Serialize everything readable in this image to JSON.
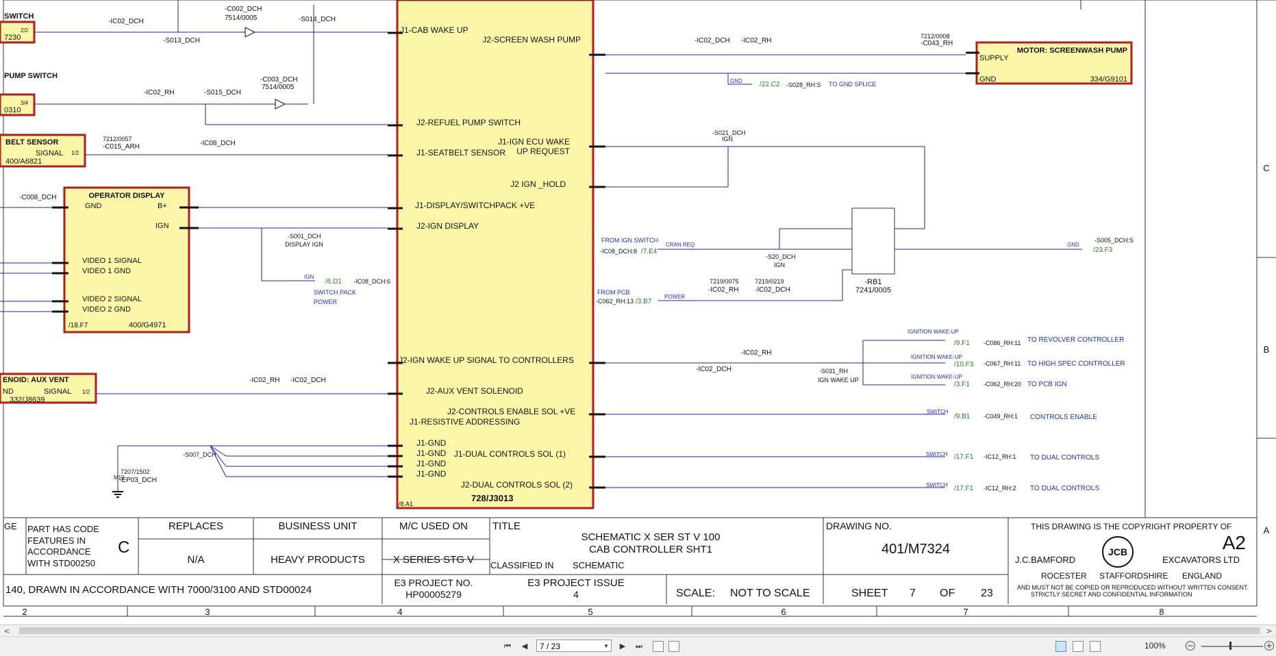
{
  "colors": {
    "wire": "#1c1ccc",
    "box_fill": "#fbf6a8",
    "box_border": "#b21e1e",
    "text": "#111111",
    "link_green": "#1e8a1e",
    "blue_text": "#1a2fcc"
  },
  "connector": {
    "lines": [
      "J1-CAB WAKE UP",
      "J2-SCREEN WASH PUMP",
      "J2-REFUEL PUMP SWITCH",
      "J1-SEATBELT SENSOR",
      "J1-IGN ECU WAKE",
      "UP REQUEST",
      "J2 IGN _HOLD",
      "J1-DISPLAY/SWITCHPACK +VE",
      "J2-IGN DISPLAY",
      "J2-IGN WAKE UP SIGNAL TO CONTROLLERS",
      "J2-AUX VENT SOLENOID",
      "J2-CONTROLS ENABLE SOL +VE",
      "J1-RESISTIVE ADDRESSING",
      "J1-GND",
      "J1-GND",
      "J1-GND",
      "J1-GND",
      "J1-DUAL CONTROLS SOL (1)",
      "J2-DUAL CONTROLS SOL (2)"
    ],
    "part": "728/J3013",
    "ref": "/8.A1"
  },
  "components": {
    "switch": {
      "title": "SWITCH",
      "code": "7230",
      "pin": "2/2"
    },
    "pump_switch": {
      "title": "PUMP SWITCH",
      "code": "0310",
      "pin": "3/4"
    },
    "belt_sensor": {
      "title": "BELT SENSOR",
      "signal": "SIGNAL",
      "pin": "1/2",
      "code": "400/A6821"
    },
    "operator_display": {
      "title": "OPERATOR DISPLAY",
      "gnd": "GND",
      "bplus": "B+",
      "ign": "IGN",
      "v1s": "VIDEO 1 SIGNAL",
      "v1g": "VIDEO 1 GND",
      "v2s": "VIDEO 2 SIGNAL",
      "v2g": "VIDEO 2 GND",
      "ref": "/18.F7",
      "code": "400/G4971"
    },
    "aux_vent": {
      "title": "ENOID: AUX VENT",
      "nd": "ND",
      "signal": "SIGNAL",
      "pin": "1/2",
      "code": "332/J8639"
    },
    "motor": {
      "title": "MOTOR: SCREENWASH PUMP",
      "supply": "SUPPLY",
      "gnd": "GND",
      "code": "334/G9101"
    },
    "relay": {
      "name": "-RB1",
      "code": "7241/0005"
    }
  },
  "wire_labels": [
    "-IC02_DCH",
    "-C002_DCH",
    "7514/0005",
    "-S014_DCH",
    "-S013_DCH",
    "-IC02_RH",
    "-S015_DCH",
    "-C003_DCH",
    "7514/0005",
    "7212/0057",
    "-C015_ARH",
    "-IC08_DCH",
    "-C008_DCH",
    "-S001_DCH",
    "DISPLAY IGN",
    "IGN",
    "/6.D1",
    "-IC08_DCH:6",
    "SWITCH PACK",
    "POWER",
    "-IC02_RH",
    "-IC02_DCH",
    "-S007_DCH",
    "7207/1502",
    "-EP03_DCH",
    "M10",
    "-IC02_DCH",
    "-IC02_RH",
    "7212/0008",
    "-C043_RH",
    "GND",
    "/22.C2",
    "-S028_RH:S",
    "TO GND SPLICE",
    "-S021_DCH",
    "IGN",
    "FROM IGN SWITCH",
    "-IC08_DCH:8",
    "/7.E4",
    "CRAN REQ",
    "-S20_DCH",
    "IGN",
    "GND",
    "-S005_DCH:S",
    "/23.F3",
    "FROM PCB",
    "-C062_RH:13",
    "/3.B7",
    "POWER",
    "7219/0075",
    "-IC02_RH",
    "7219/0219",
    "-IC02_DCH",
    "-IC02_DCH",
    "-IC02_RH",
    "-S031_RH",
    "IGN WAKE UP",
    "IGNITION WAKE-UP",
    "/9.F1",
    "-C086_RH:11",
    "TO REVOLVER CONTROLLER",
    "IGNITION WAKE-UP",
    "/10.F3",
    "-C067_RH:11",
    "TO HIGH SPEC CONTROLLER",
    "IGNITION WAKE-UP",
    "/3.F1",
    "-C062_RH:20",
    "TO PCB IGN",
    "SWITCH",
    "/9.B1",
    "-C049_RH:1",
    "CONTROLS ENABLE",
    "SWITCH",
    "/17.F1",
    "-IC12_RH:1",
    "TO DUAL CONTROLS",
    "SWITCH",
    "/17.F1",
    "-IC12_RH:2",
    "TO DUAL CONTROLS"
  ],
  "title_block": {
    "part_code_text": [
      "PART HAS CODE",
      "FEATURES IN",
      "ACCORDANCE",
      "WITH STD00250"
    ],
    "code_letter": "C",
    "ge": "GE",
    "replaces_h": "REPLACES",
    "replaces_v": "N/A",
    "bu_h": "BUSINESS UNIT",
    "bu_v": "HEAVY PRODUCTS",
    "mc_h": "M/C USED ON",
    "mc_v": "X SERIES STG V",
    "title_h": "TITLE",
    "title_1": "SCHEMATIC X SER ST V 100",
    "title_2": "CAB CONTROLLER SHT1",
    "classified_h": "CLASSIFIED IN",
    "classified_v": "SCHEMATIC",
    "drawing_h": "DRAWING NO.",
    "drawing_v": "401/M7324",
    "copyright": "THIS DRAWING IS THE COPYRIGHT PROPERTY OF",
    "size": "A2",
    "company": "J.C.BAMFORD",
    "company2": "EXCAVATORS LTD",
    "logo": "JCB",
    "addr1": "ROCESTER",
    "addr2": "STAFFORDSHIRE",
    "addr3": "ENGLAND",
    "secret1": "AND MUST NOT BE COPIED OR REPRODUCED WITHOUT WRITTEN CONSENT.",
    "secret2": "STRICTLY SECRET AND CONFIDENTIAL INFORMATION",
    "drawn": "140, DRAWN IN ACCORDANCE WITH 7000/3100 AND STD00024",
    "e3p_h": "E3 PROJECT NO.",
    "e3p_v": "HP00005279",
    "e3i_h": "E3 PROJECT ISSUE",
    "e3i_v": "4",
    "scale_h": "SCALE:",
    "scale_v": "NOT TO SCALE",
    "sheet_h": "SHEET",
    "sheet_n": "7",
    "of": "OF",
    "sheet_t": "23"
  },
  "grid": {
    "cols": [
      "2",
      "3",
      "4",
      "5",
      "6",
      "7",
      "8"
    ],
    "rows": [
      "C",
      "B",
      "A"
    ]
  },
  "toolbar": {
    "page": "7 / 23",
    "zoom": "100%",
    "first": "first-page",
    "prev": "previous-page",
    "next": "next-page",
    "last": "last-page"
  }
}
